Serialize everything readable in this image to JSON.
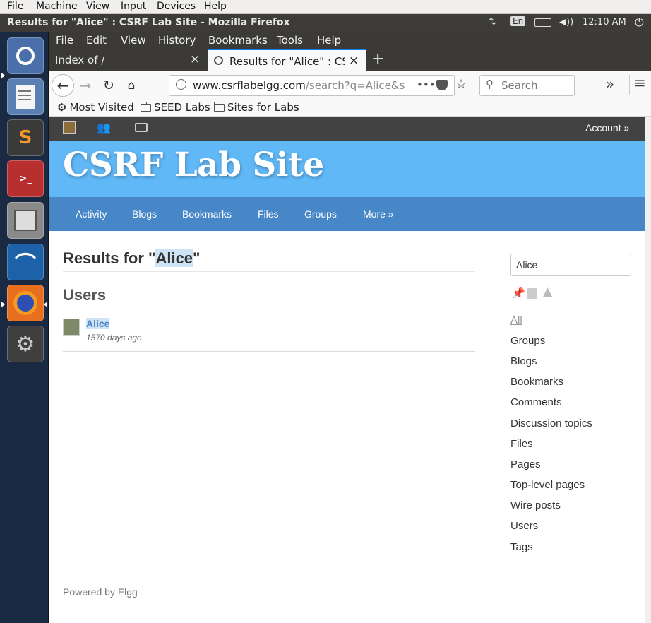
{
  "vbox_menu": [
    "File",
    "Machine",
    "View",
    "Input",
    "Devices",
    "Help"
  ],
  "window_title": "Results for \"Alice\" : CSRF Lab Site - Mozilla Firefox",
  "tray": {
    "keyboard": "En",
    "clock": "12:10 AM"
  },
  "firefox_menu": [
    "File",
    "Edit",
    "View",
    "History",
    "Bookmarks",
    "Tools",
    "Help"
  ],
  "tabs": [
    {
      "label": "Index of /",
      "close": "×"
    },
    {
      "label": "Results for \"Alice\" : CSRF",
      "close": "×"
    }
  ],
  "new_tab": "+",
  "url": {
    "host": "www.csrflabelgg.com",
    "path": "/search?q=Alice&se",
    "dots": "•••"
  },
  "search_placeholder": "Search",
  "overflow": "»",
  "hamburger": "≡",
  "bookmarks": [
    "Most Visited",
    "SEED Labs",
    "Sites for Labs"
  ],
  "elgg": {
    "account": "Account »",
    "site_title": "CSRF Lab Site",
    "nav": [
      "Activity",
      "Blogs",
      "Bookmarks",
      "Files",
      "Groups",
      "More »"
    ],
    "results_prefix": "Results for \"",
    "query": "Alice",
    "results_suffix": "\"",
    "users_heading": "Users",
    "result_name": "Alice",
    "result_time": "1570 days ago",
    "sidebar_search_value": "Alice",
    "sidebar_links": [
      "All",
      "Groups",
      "Blogs",
      "Bookmarks",
      "Comments",
      "Discussion topics",
      "Files",
      "Pages",
      "Top-level pages",
      "Wire posts",
      "Users",
      "Tags"
    ],
    "footer": "Powered by Elgg"
  },
  "colors": {
    "header": "#60b8f7",
    "nav": "#4787c7",
    "topbar": "#424242",
    "launcher": "#1b2a43"
  }
}
